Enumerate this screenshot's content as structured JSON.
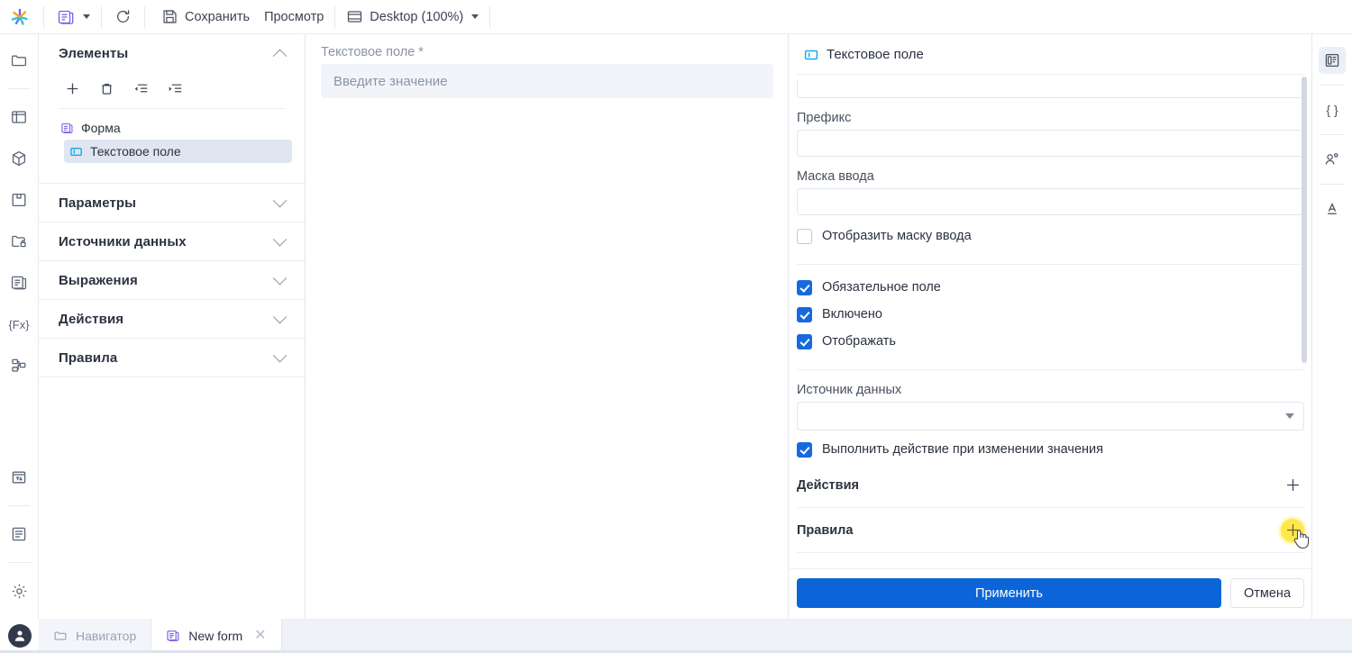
{
  "toolbar": {
    "logo_icon": "app-logo-star-icon",
    "doc_icon": "form-document-icon",
    "doc_caret_icon": "chevron-down-icon",
    "refresh_icon": "refresh-icon",
    "save_icon": "save-floppy-icon",
    "save_label": "Сохранить",
    "preview_label": "Просмотр",
    "viewport_icon": "desktop-viewport-icon",
    "viewport_label": "Desktop (100%)",
    "viewport_caret_icon": "chevron-down-icon"
  },
  "left_rail": {
    "items": [
      {
        "name": "folder-icon"
      },
      {
        "name": "layout-panel-icon"
      },
      {
        "name": "cube-icon"
      },
      {
        "name": "save-module-icon"
      },
      {
        "name": "folder-lock-icon"
      },
      {
        "name": "form-document-icon"
      },
      {
        "name": "fx-expression-icon"
      },
      {
        "name": "workflow-nodes-icon"
      }
    ],
    "bottom_items": [
      {
        "name": "import-export-icon"
      },
      {
        "name": "log-list-icon"
      },
      {
        "name": "settings-gear-icon"
      }
    ]
  },
  "left_panel": {
    "sections": [
      {
        "title": "Элементы",
        "expanded": true
      },
      {
        "title": "Параметры",
        "expanded": false
      },
      {
        "title": "Источники данных",
        "expanded": false
      },
      {
        "title": "Выражения",
        "expanded": false
      },
      {
        "title": "Действия",
        "expanded": false
      },
      {
        "title": "Правила",
        "expanded": false
      }
    ],
    "tree_tools": [
      {
        "name": "add-element-icon",
        "title": "Добавить"
      },
      {
        "name": "delete-element-icon",
        "title": "Удалить"
      },
      {
        "name": "outdent-element-icon",
        "title": "Сдвинуть влево"
      },
      {
        "name": "indent-element-icon",
        "title": "Сдвинуть вправо"
      }
    ],
    "tree": [
      {
        "label": "Форма",
        "icon": "form-document-icon",
        "selected": false,
        "level": 0
      },
      {
        "label": "Текстовое поле",
        "icon": "text-field-icon",
        "selected": true,
        "level": 1
      }
    ]
  },
  "canvas": {
    "field_label": "Текстовое поле *",
    "field_placeholder": "Введите значение"
  },
  "properties": {
    "header_icon": "text-field-icon",
    "header_title": "Текстовое поле",
    "top_input_value": "",
    "prefix_label": "Префикс",
    "prefix_value": "",
    "mask_label": "Маска ввода",
    "mask_value": "",
    "show_mask_label": "Отобразить маску ввода",
    "show_mask_checked": false,
    "required_label": "Обязательное поле",
    "required_checked": true,
    "enabled_label": "Включено",
    "enabled_checked": true,
    "visible_label": "Отображать",
    "visible_checked": true,
    "datasource_label": "Источник данных",
    "datasource_value": "",
    "datasource_caret_icon": "chevron-down-icon",
    "on_change_label": "Выполнить действие при изменении значения",
    "on_change_checked": true,
    "actions_title": "Действия",
    "actions_add_icon": "plus-icon",
    "rules_title": "Правила",
    "rules_add_icon": "plus-icon",
    "apply_label": "Применить",
    "cancel_label": "Отмена",
    "accent_color": "#0b65d8",
    "checkbox_color": "#1769e0",
    "click_highlight_color": "#ffe94a",
    "scrollbar_name": "properties-scrollbar"
  },
  "right_rail": {
    "items": [
      {
        "name": "properties-panel-icon",
        "active": true
      },
      {
        "name": "json-braces-icon",
        "active": false
      },
      {
        "name": "permissions-icon",
        "active": false
      },
      {
        "name": "typography-icon",
        "active": false
      }
    ]
  },
  "bottom_bar": {
    "avatar_icon": "user-avatar-icon",
    "tabs": [
      {
        "label": "Навигатор",
        "icon": "folder-icon",
        "active": false,
        "closable": false
      },
      {
        "label": "New form",
        "icon": "form-document-icon",
        "active": true,
        "closable": true,
        "close_icon": "close-icon"
      }
    ]
  }
}
